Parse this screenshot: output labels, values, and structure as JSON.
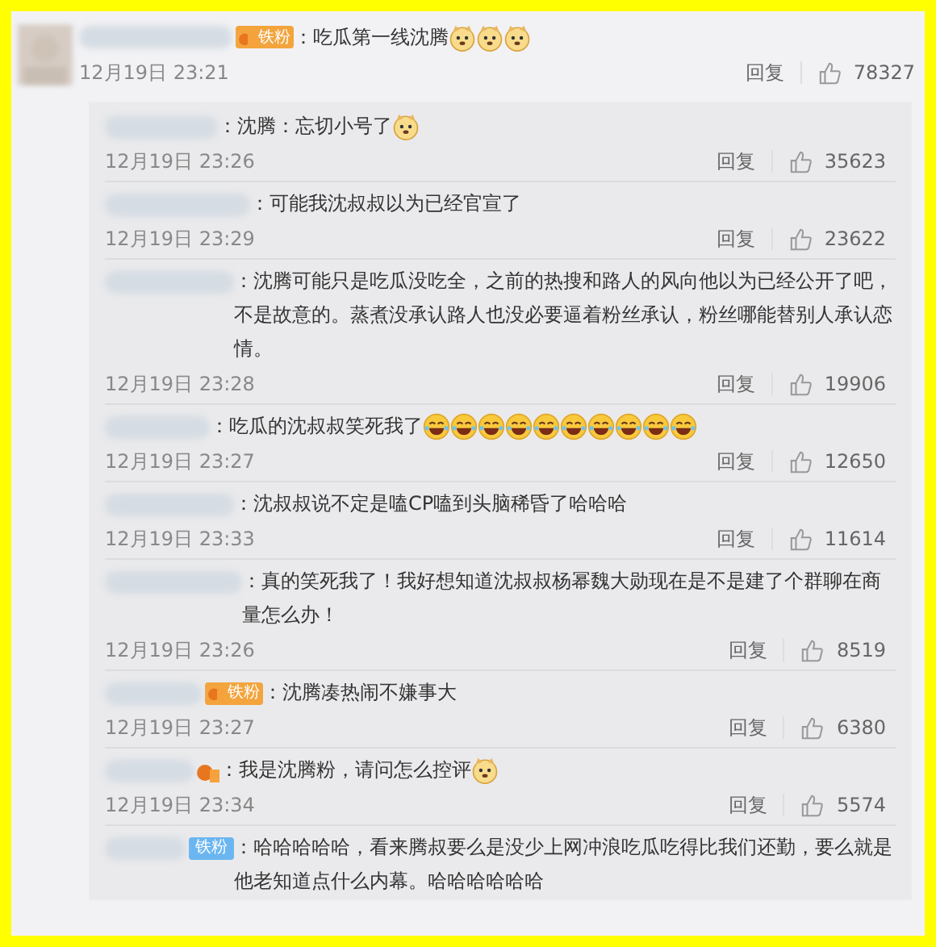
{
  "comment": {
    "badge": {
      "kind": "fan-orange",
      "label": "铁粉"
    },
    "text": "：吃瓜第一线沈腾",
    "emojis": [
      {
        "kind": "doge"
      },
      {
        "kind": "doge"
      },
      {
        "kind": "doge"
      }
    ],
    "time": "12月19日 23:21",
    "reply_label": "回复",
    "likes": "78327"
  },
  "replies": [
    {
      "text": "：沈腾：忘切小号了",
      "emojis": [
        {
          "kind": "doge"
        }
      ],
      "time": "12月19日 23:26",
      "reply_label": "回复",
      "likes": "35623"
    },
    {
      "text": "：可能我沈叔叔以为已经官宣了",
      "time": "12月19日 23:29",
      "reply_label": "回复",
      "likes": "23622"
    },
    {
      "text": "：沈腾可能只是吃瓜没吃全，之前的热搜和路人的风向他以为已经公开了吧，不是故意的。蒸煮没承认路人也没必要逼着粉丝承认，粉丝哪能替别人承认恋情。",
      "time": "12月19日 23:28",
      "reply_label": "回复",
      "likes": "19906"
    },
    {
      "text": "：吃瓜的沈叔叔笑死我了",
      "emojis": [
        {
          "kind": "laugh"
        },
        {
          "kind": "laugh"
        },
        {
          "kind": "laugh"
        },
        {
          "kind": "laugh"
        },
        {
          "kind": "laugh"
        },
        {
          "kind": "laugh"
        },
        {
          "kind": "laugh"
        },
        {
          "kind": "laugh"
        },
        {
          "kind": "laugh"
        },
        {
          "kind": "laugh"
        }
      ],
      "time": "12月19日 23:27",
      "reply_label": "回复",
      "likes": "12650"
    },
    {
      "text": "：沈叔叔说不定是嗑CP嗑到头脑稀昏了哈哈哈",
      "time": "12月19日 23:33",
      "reply_label": "回复",
      "likes": "11614"
    },
    {
      "text": "：真的笑死我了！我好想知道沈叔叔杨幂魏大勋现在是不是建了个群聊在商量怎么办！",
      "time": "12月19日 23:26",
      "reply_label": "回复",
      "likes": "8519"
    },
    {
      "badge": {
        "kind": "fan-orange",
        "label": "铁粉"
      },
      "text": "：沈腾凑热闹不嫌事大",
      "time": "12月19日 23:27",
      "reply_label": "回复",
      "likes": "6380"
    },
    {
      "badge": {
        "kind": "fan-icon"
      },
      "text": "：我是沈腾粉，请问怎么控评",
      "emojis": [
        {
          "kind": "doge"
        }
      ],
      "time": "12月19日 23:34",
      "reply_label": "回复",
      "likes": "5574"
    },
    {
      "badge": {
        "kind": "fan-blue",
        "label": "铁粉"
      },
      "text": "：哈哈哈哈哈，看来腾叔要么是没少上网冲浪吃瓜吃得比我们还勤，要么就是他老知道点什么内幕。哈哈哈哈哈哈"
    }
  ]
}
